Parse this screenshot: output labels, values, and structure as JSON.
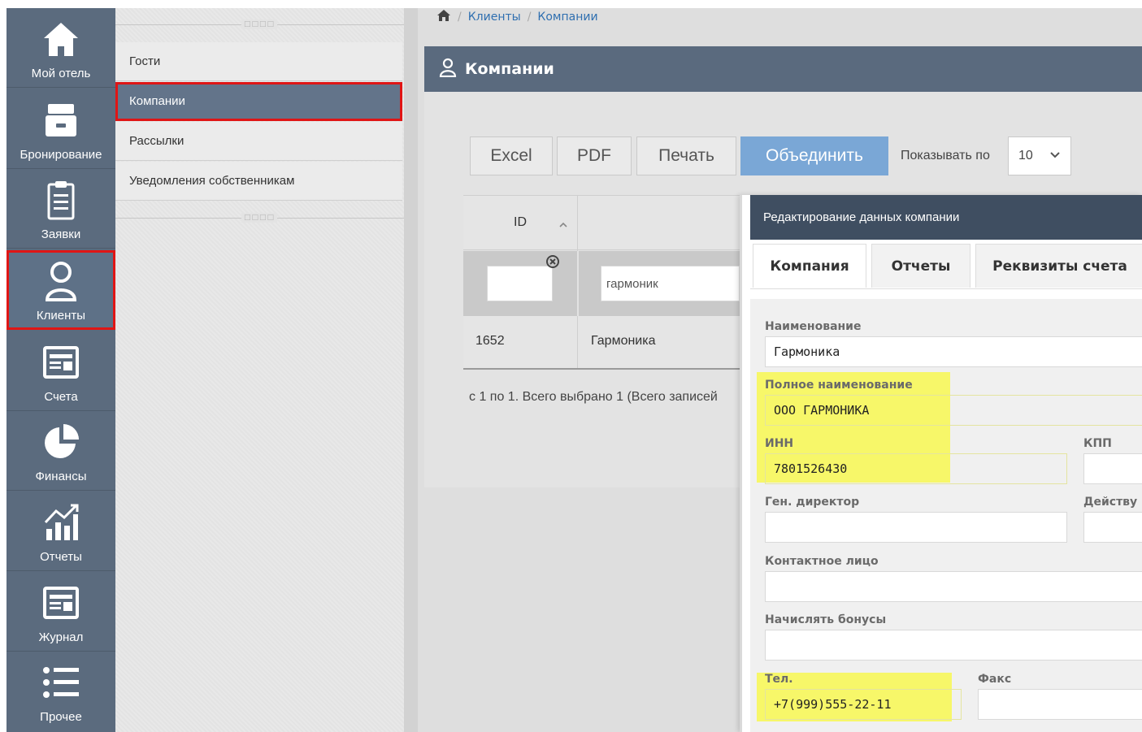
{
  "sidebar": {
    "items": [
      {
        "id": "home",
        "label": "Мой отель",
        "icon": "home-icon"
      },
      {
        "id": "booking",
        "label": "Бронирование",
        "icon": "inbox-icon"
      },
      {
        "id": "requests",
        "label": "Заявки",
        "icon": "clipboard-icon"
      },
      {
        "id": "clients",
        "label": "Клиенты",
        "icon": "user-icon"
      },
      {
        "id": "invoices",
        "label": "Счета",
        "icon": "invoice-icon"
      },
      {
        "id": "finance",
        "label": "Финансы",
        "icon": "pie-chart-icon"
      },
      {
        "id": "reports",
        "label": "Отчеты",
        "icon": "bar-chart-icon"
      },
      {
        "id": "journal",
        "label": "Журнал",
        "icon": "journal-icon"
      },
      {
        "id": "other",
        "label": "Прочее",
        "icon": "list-icon"
      }
    ],
    "active": "clients"
  },
  "submenu": {
    "items": [
      {
        "label": "Гости"
      },
      {
        "label": "Компании"
      },
      {
        "label": "Рассылки"
      },
      {
        "label": "Уведомления собственникам"
      }
    ],
    "active": "Компании"
  },
  "breadcrumb": {
    "items": [
      "Клиенты",
      "Компании"
    ]
  },
  "panel": {
    "title": "Компании"
  },
  "toolbar": {
    "excel": "Excel",
    "pdf": "PDF",
    "print": "Печать",
    "merge": "Объединить",
    "show_per_page_label": "Показывать по",
    "page_size": "10"
  },
  "table": {
    "columns": [
      "ID",
      ""
    ],
    "filter": {
      "name_value": "гармоник"
    },
    "rows": [
      {
        "id": "1652",
        "name": "Гармоника"
      }
    ],
    "footer": "с 1 по 1. Всего выбрано 1 (Всего записей"
  },
  "modal": {
    "title": "Редактирование данных компании",
    "tabs": [
      "Компания",
      "Отчеты",
      "Реквизиты счета"
    ],
    "active_tab": "Компания",
    "fields": {
      "name": {
        "label": "Наименование",
        "value": "Гармоника"
      },
      "full_name": {
        "label": "Полное наименование",
        "value": "ООО ГАРМОНИКА"
      },
      "inn": {
        "label": "ИНН",
        "value": "7801526430"
      },
      "kpp": {
        "label": "КПП",
        "value": ""
      },
      "director": {
        "label": "Ген. директор",
        "value": ""
      },
      "acting": {
        "label": "Действу",
        "value": ""
      },
      "contact": {
        "label": "Контактное лицо",
        "value": ""
      },
      "bonus": {
        "label": "Начислять бонусы",
        "value": ""
      },
      "phone": {
        "label": "Тел.",
        "value": "+7(999)555-22-11"
      },
      "fax": {
        "label": "Факс",
        "value": ""
      }
    }
  },
  "colors": {
    "sidebar_bg": "#5b6b7e",
    "header_bg": "#5a6a7e",
    "modal_header_bg": "#3f4e61",
    "highlight_red": "#e01515",
    "highlight_yellow": "#fafa3c",
    "primary_button": "#7aa7d6",
    "link": "#2f6fb0"
  }
}
